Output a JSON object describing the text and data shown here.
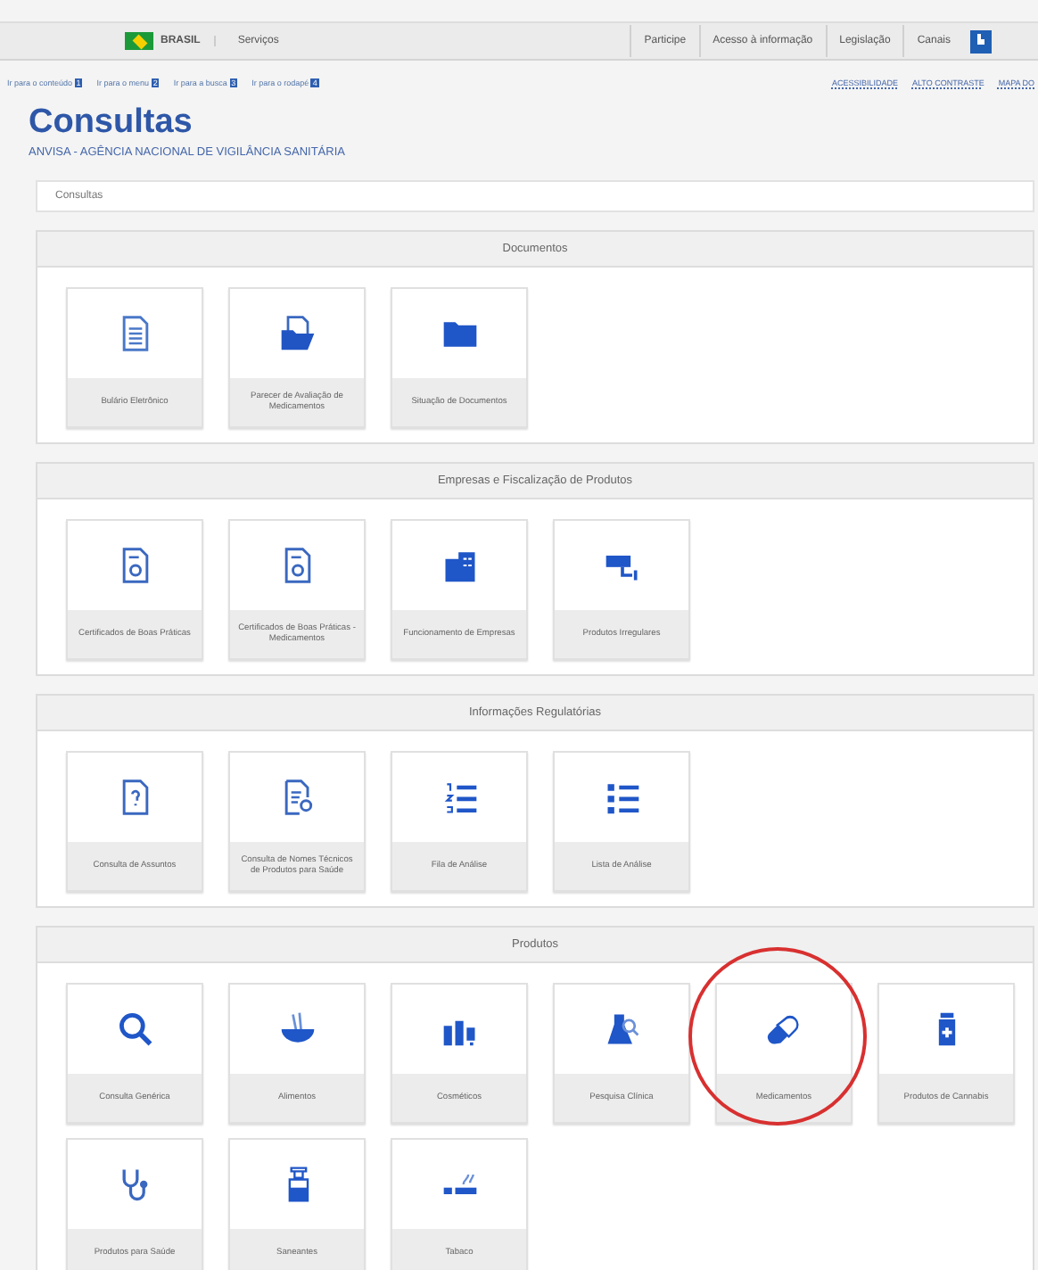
{
  "gov_bar": {
    "country": "BRASIL",
    "services": "Serviços",
    "links": [
      "Participe",
      "Acesso à informação",
      "Legislação",
      "Canais"
    ]
  },
  "skip_links": [
    {
      "label": "Ir para o conteúdo",
      "key": "1"
    },
    {
      "label": "Ir para o menu",
      "key": "2"
    },
    {
      "label": "Ir para a busca",
      "key": "3"
    },
    {
      "label": "Ir para o rodapé",
      "key": "4"
    }
  ],
  "utility_links": [
    "ACESSIBILIDADE",
    "ALTO CONTRASTE",
    "MAPA DO"
  ],
  "header": {
    "title": "Consultas",
    "subtitle": "ANVISA - AGÊNCIA NACIONAL DE VIGILÂNCIA SANITÁRIA"
  },
  "breadcrumb": "Consultas",
  "sections": [
    {
      "title": "Documentos",
      "tiles": [
        {
          "label": "Bulário Eletrônico",
          "highlighted": false
        },
        {
          "label": "Parecer de Avaliação de Medicamentos",
          "highlighted": false
        },
        {
          "label": "Situação de Documentos",
          "highlighted": false
        }
      ]
    },
    {
      "title": "Empresas e Fiscalização de Produtos",
      "tiles": [
        {
          "label": "Certificados de Boas Práticas",
          "highlighted": false
        },
        {
          "label": "Certificados de Boas Práticas - Medicamentos",
          "highlighted": false
        },
        {
          "label": "Funcionamento de Empresas",
          "highlighted": false
        },
        {
          "label": "Produtos Irregulares",
          "highlighted": false
        }
      ]
    },
    {
      "title": "Informações Regulatórias",
      "tiles": [
        {
          "label": "Consulta de Assuntos",
          "highlighted": false
        },
        {
          "label": "Consulta de Nomes Técnicos de Produtos para Saúde",
          "highlighted": false
        },
        {
          "label": "Fila de Análise",
          "highlighted": false
        },
        {
          "label": "Lista de Análise",
          "highlighted": false
        }
      ]
    },
    {
      "title": "Produtos",
      "tiles": [
        {
          "label": "Consulta Genérica",
          "highlighted": false
        },
        {
          "label": "Alimentos",
          "highlighted": false
        },
        {
          "label": "Cosméticos",
          "highlighted": false
        },
        {
          "label": "Pesquisa Clínica",
          "highlighted": false
        },
        {
          "label": "Medicamentos",
          "highlighted": true
        },
        {
          "label": "Produtos de Cannabis",
          "highlighted": false
        },
        {
          "label": "Produtos para Saúde",
          "highlighted": false
        },
        {
          "label": "Saneantes",
          "highlighted": false
        },
        {
          "label": "Tabaco",
          "highlighted": false
        }
      ]
    }
  ]
}
